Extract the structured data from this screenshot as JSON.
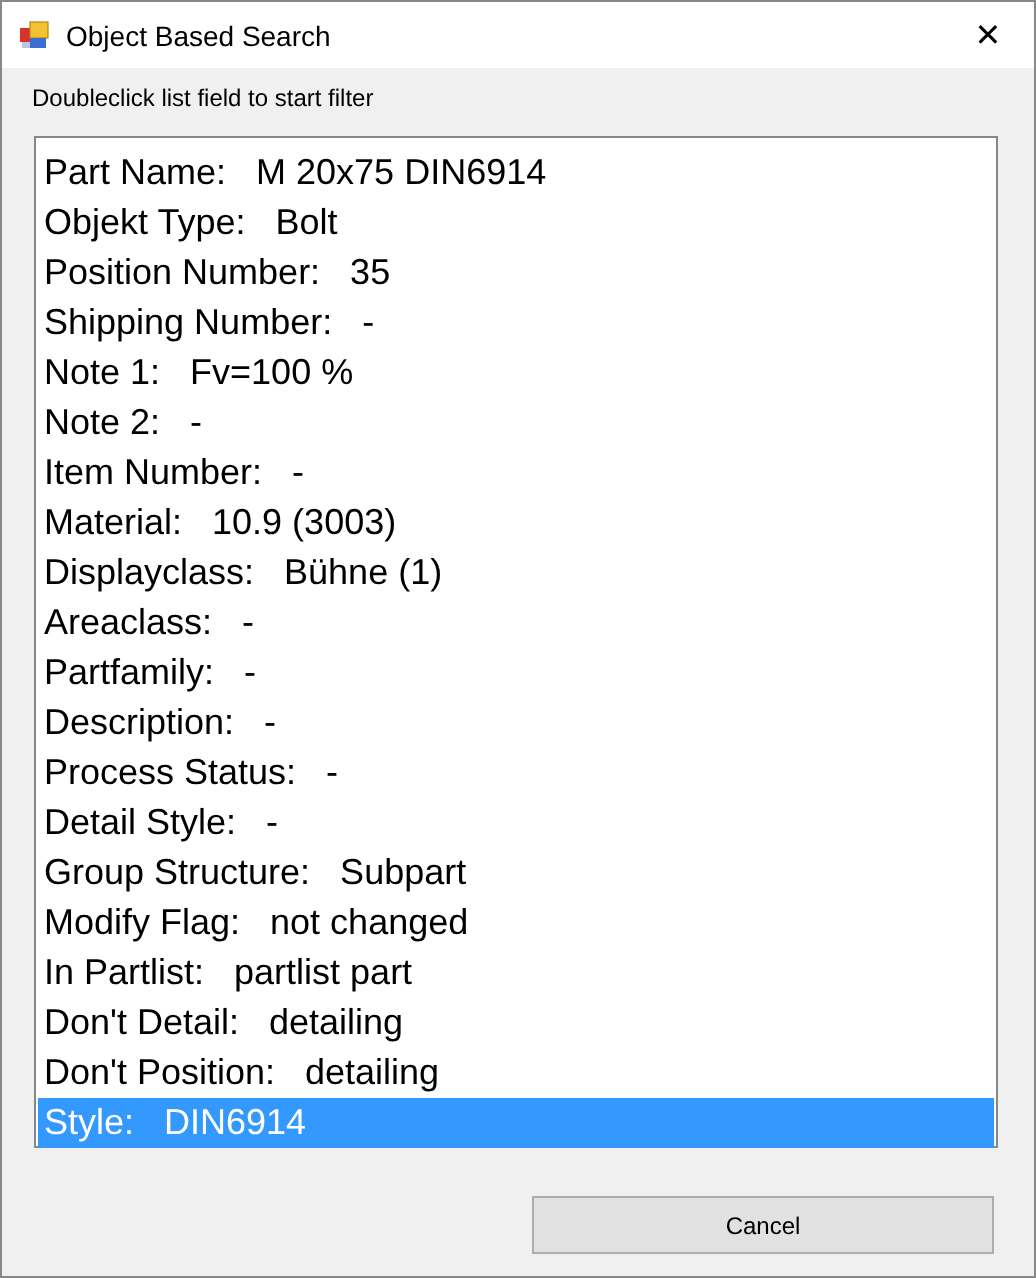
{
  "window": {
    "title": "Object Based Search",
    "close": "✕"
  },
  "hint": "Doubleclick list field to start filter",
  "list": [
    {
      "text": "Part Name:   M 20x75 DIN6914",
      "selected": false
    },
    {
      "text": "Objekt Type:   Bolt",
      "selected": false
    },
    {
      "text": "Position Number:   35",
      "selected": false
    },
    {
      "text": "Shipping Number:   -",
      "selected": false
    },
    {
      "text": "Note 1:   Fv=100 %",
      "selected": false
    },
    {
      "text": "Note 2:   -",
      "selected": false
    },
    {
      "text": "Item Number:   -",
      "selected": false
    },
    {
      "text": "Material:   10.9 (3003)",
      "selected": false
    },
    {
      "text": "Displayclass:   Bühne (1)",
      "selected": false
    },
    {
      "text": "Areaclass:   -",
      "selected": false
    },
    {
      "text": "Partfamily:   -",
      "selected": false
    },
    {
      "text": "Description:   -",
      "selected": false
    },
    {
      "text": "Process Status:   -",
      "selected": false
    },
    {
      "text": "Detail Style:   -",
      "selected": false
    },
    {
      "text": "Group Structure:   Subpart",
      "selected": false
    },
    {
      "text": "Modify Flag:   not changed",
      "selected": false
    },
    {
      "text": "In Partlist:   partlist part",
      "selected": false
    },
    {
      "text": "Don't Detail:   detailing",
      "selected": false
    },
    {
      "text": "Don't Position:   detailing",
      "selected": false
    },
    {
      "text": "Style:   DIN6914",
      "selected": true
    }
  ],
  "buttons": [
    "Cancel"
  ]
}
